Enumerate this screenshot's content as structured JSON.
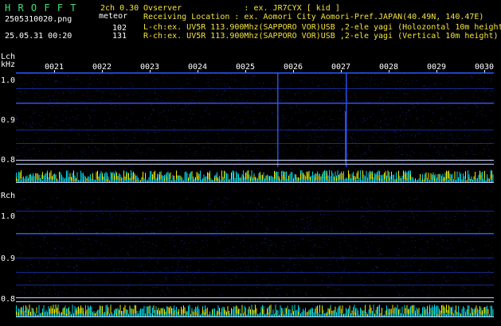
{
  "header": {
    "app_name": "H R O F F T",
    "mode": "2ch 0.30",
    "filename": "2505310020.png",
    "meteor_label": "meteor",
    "date_time": "25.05.31 00:20",
    "lch_count": "102",
    "rch_count": "131",
    "observer_line": "Ovserver             : ex. JR7CYX [ kid ]",
    "location_line": "Receiving Location : ex. Aomori City Aomori-Pref.JAPAN(40.49N, 140.47E)",
    "lch_line": "L-ch:ex. UV5R 113.900Mhz(SAPPORO VOR)USB ,2-ele yagi (Holozontal 10m height)",
    "rch_line": "R-ch:ex. UV5R 113.900Mhz(SAPPORO VOR)USB ,2-ele yagi (Vertical 10m height)"
  },
  "colors": {
    "background": "#000000",
    "signal": "#2a58ff",
    "bar_yellow": "#f0f000",
    "bar_cyan": "#00d8e8",
    "text_yellow": "#f5e342",
    "text_green": "#3ee07a"
  },
  "panels": {
    "left": {
      "channel_label": "Lch",
      "unit_label": "kHz",
      "y_labels": [
        "1.0",
        "0.9",
        "0.8"
      ],
      "time_labels": [
        "0021",
        "0022",
        "0023",
        "0024",
        "0025",
        "0026",
        "0027",
        "0028",
        "0029",
        "0030"
      ]
    },
    "right": {
      "channel_label": "Rch",
      "y_labels": [
        "1.0",
        "0.9",
        "0.8"
      ]
    }
  }
}
